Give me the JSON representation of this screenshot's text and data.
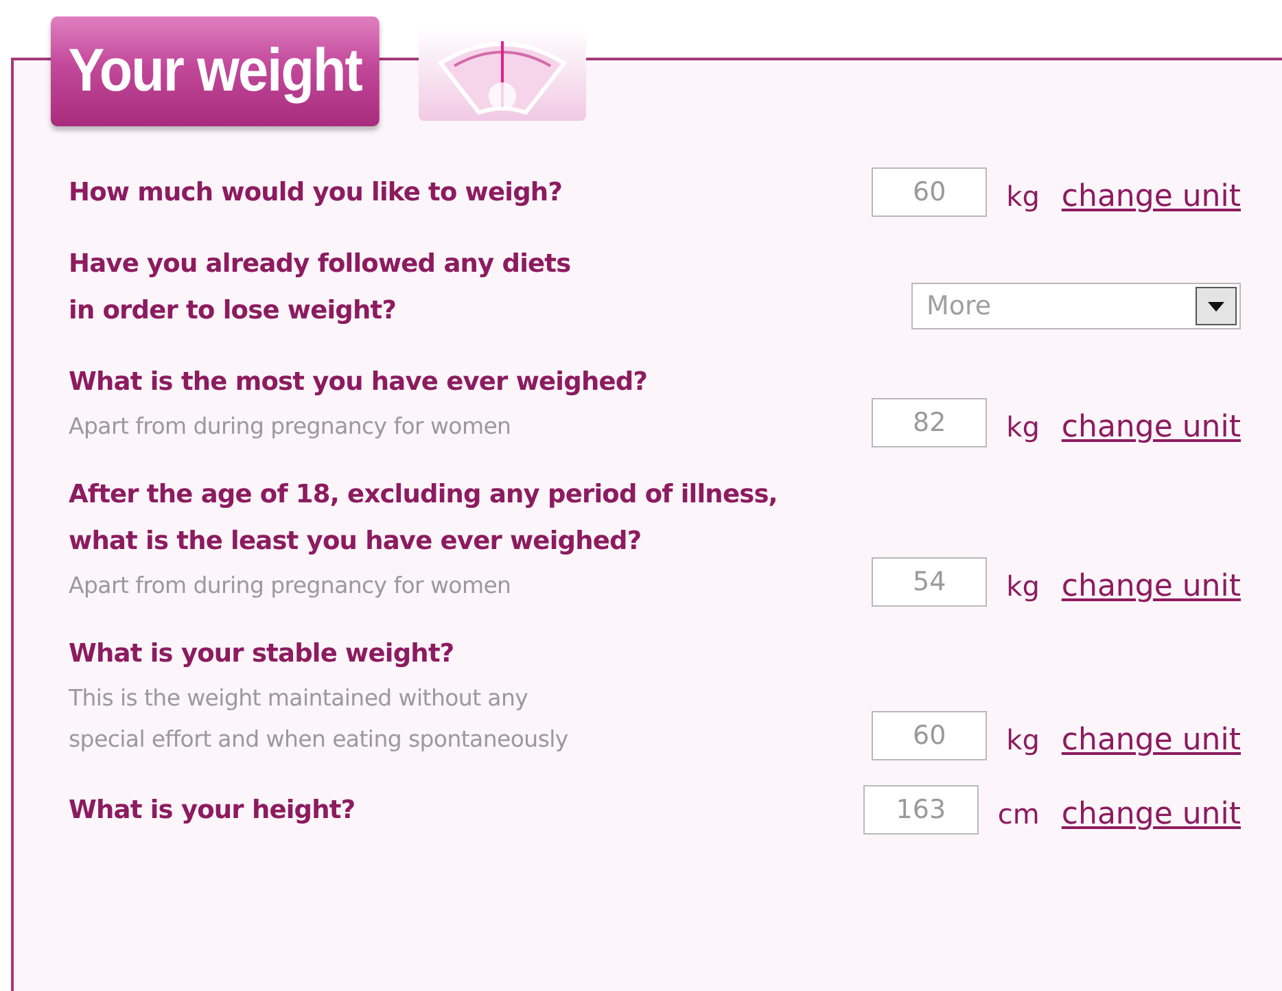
{
  "section_title": "Your weight",
  "questions": [
    {
      "kind": "number",
      "question": "How much would you like to weigh?",
      "value": "60",
      "unit": "kg",
      "link": "change unit"
    },
    {
      "kind": "select",
      "question": "Have you already followed any diets\nin order to lose weight?",
      "value": "More"
    },
    {
      "kind": "number",
      "question": "What is the most you have ever weighed?",
      "hint": "Apart from during pregnancy for women",
      "value": "82",
      "unit": "kg",
      "link": "change unit"
    },
    {
      "kind": "number",
      "question": "After the age of 18, excluding any period of illness,\nwhat is the least you have ever weighed?",
      "hint": "Apart from during pregnancy for women",
      "value": "54",
      "unit": "kg",
      "link": "change unit"
    },
    {
      "kind": "number",
      "question": "What is your stable weight?",
      "hint": "This is the weight maintained without any\nspecial effort and when eating spontaneously",
      "value": "60",
      "unit": "kg",
      "link": "change unit"
    },
    {
      "kind": "number",
      "question": "What is your height?",
      "value": "163",
      "unit": "cm",
      "link": "change unit"
    }
  ]
}
